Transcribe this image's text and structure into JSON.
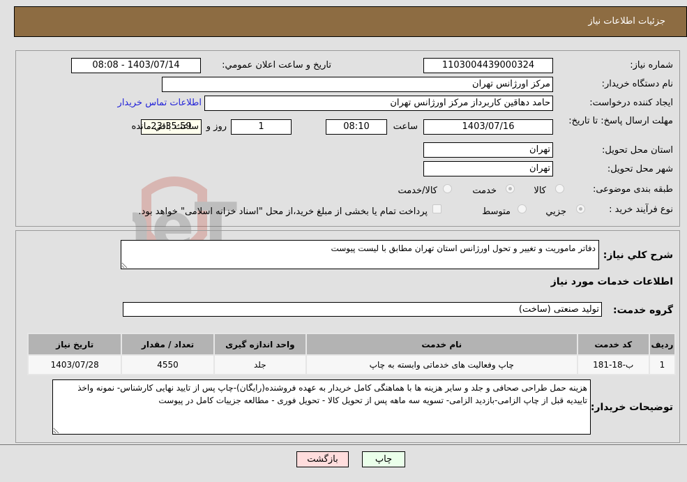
{
  "header": {
    "title": "جزئيات اطلاعات نياز"
  },
  "details": {
    "need_number_label": "شماره نياز:",
    "need_number": "1103004439000324",
    "announce_label": "تاريخ و ساعت اعلان عمومي:",
    "announce_value": "1403/07/14 - 08:08",
    "buyer_org_label": "نام دستگاه خريدار:",
    "buyer_org": "مركز اورژانس تهران",
    "buyer_org_extra": "",
    "requester_label": "ايجاد كننده درخواست:",
    "requester": "حامد دهاقين كاربرداز مركز اورژانس تهران",
    "contact_link": "اطلاعات تماس خريدار",
    "deadline_label": "مهلت ارسال پاسخ: تا تاريخ:",
    "deadline_date": "1403/07/16",
    "time_label": "ساعت",
    "deadline_time": "08:10",
    "days_value": "1",
    "days_label": "روز و",
    "remaining_time": "23:35:59",
    "remaining_label": "ساعت باقي مانده",
    "province_label": "استان محل تحويل:",
    "province": "تهران",
    "city_label": "شهر محل تحويل:",
    "city": "تهران",
    "category_label": "طبقه بندی موضوعی:",
    "category_options": [
      "كالا",
      "خدمت",
      "كالا/خدمت"
    ],
    "category_selected": "خدمت",
    "process_label": "نوع فرآيند خريد :",
    "process_options": [
      "جزيي",
      "متوسط"
    ],
    "process_selected": "جزيي",
    "treasury_note": "پرداخت تمام يا بخشی از مبلغ خريد،از محل \"اسناد خزانه اسلامی\" خواهد بود."
  },
  "summary": {
    "general_desc_label": "شرح كلي نياز:",
    "general_desc": "دفاتر ماموريت و تغيير و تحول اورژانس استان تهران مطابق با ليست پيوست",
    "services_heading": "اطلاعات خدمات مورد نياز",
    "service_group_label": "گروه خدمت:",
    "service_group": "توليد صنعتی (ساخت)"
  },
  "table": {
    "headers": [
      "رديف",
      "كد خدمت",
      "نام خدمت",
      "واحد اندازه گيری",
      "تعداد / مقدار",
      "تاريخ نياز"
    ],
    "rows": [
      [
        "1",
        "ب-18-181",
        "چاپ وفعاليت های خدماتی وابسته به چاپ",
        "جلد",
        "4550",
        "1403/07/28"
      ]
    ]
  },
  "buyer_notes": {
    "label": "توضيحات خريدار:",
    "text": "هزينه حمل طراحی صحافی و جلد و ساير هزينه ها با هماهنگی كامل خريدار به عهده فروشنده(رايگان)-چاپ پس از تاييد نهايی كارشناس- نمونه واخذ تاييديه قبل از چاپ الزامی-بازديد الزامی- تسويه سه ماهه پس از تحويل كالا - تحويل فوری - مطالعه جزييات كامل در پيوست"
  },
  "buttons": {
    "print": "چاپ",
    "back": "بازگشت"
  },
  "colors": {
    "header_bg": "#8d6c42",
    "print_bg": "#eaffea",
    "back_bg": "#ffdddd",
    "link": "#2323d8"
  }
}
